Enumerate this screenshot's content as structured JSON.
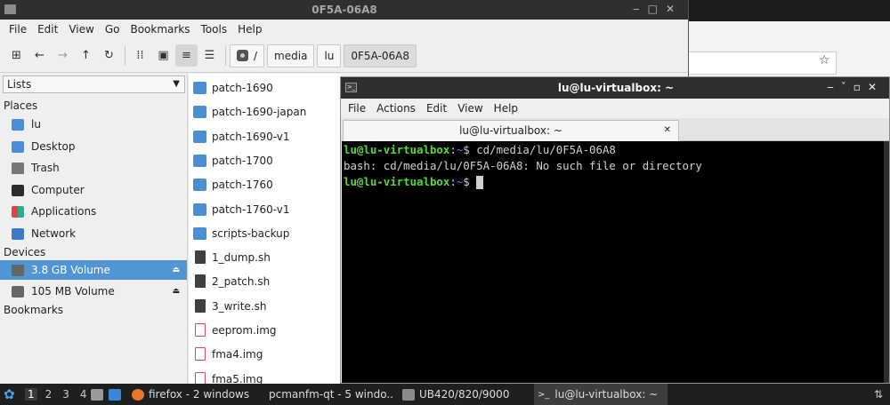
{
  "file_manager": {
    "title": "0F5A-06A8",
    "menu": [
      "File",
      "Edit",
      "View",
      "Go",
      "Bookmarks",
      "Tools",
      "Help"
    ],
    "path_crumbs": [
      "/",
      "media",
      "lu",
      "0F5A-06A8"
    ],
    "sidebar": {
      "mode": "Lists",
      "places_header": "Places",
      "places": [
        {
          "label": "lu",
          "icon": "home-folder-icon"
        },
        {
          "label": "Desktop",
          "icon": "folder-icon"
        },
        {
          "label": "Trash",
          "icon": "trash-icon"
        },
        {
          "label": "Computer",
          "icon": "computer-icon"
        },
        {
          "label": "Applications",
          "icon": "applications-icon"
        },
        {
          "label": "Network",
          "icon": "network-icon"
        }
      ],
      "devices_header": "Devices",
      "devices": [
        {
          "label": "3.8 GB Volume",
          "icon": "drive-icon",
          "selected": true
        },
        {
          "label": "105 MB Volume",
          "icon": "drive-icon",
          "selected": false
        }
      ],
      "bookmarks_header": "Bookmarks"
    },
    "files": [
      {
        "name": "patch-1690",
        "type": "folder"
      },
      {
        "name": "patch-1690-japan",
        "type": "folder"
      },
      {
        "name": "patch-1690-v1",
        "type": "folder"
      },
      {
        "name": "patch-1700",
        "type": "folder"
      },
      {
        "name": "patch-1760",
        "type": "folder"
      },
      {
        "name": "patch-1760-v1",
        "type": "folder"
      },
      {
        "name": "scripts-backup",
        "type": "folder"
      },
      {
        "name": "1_dump.sh",
        "type": "script"
      },
      {
        "name": "2_patch.sh",
        "type": "script"
      },
      {
        "name": "3_write.sh",
        "type": "script"
      },
      {
        "name": "eeprom.img",
        "type": "image"
      },
      {
        "name": "fma4.img",
        "type": "image"
      },
      {
        "name": "fma5.img",
        "type": "image"
      }
    ]
  },
  "terminal": {
    "title": "lu@lu-virtualbox: ~",
    "menu": [
      "File",
      "Actions",
      "Edit",
      "View",
      "Help"
    ],
    "tab_label": "lu@lu-virtualbox: ~",
    "prompt_user": "lu@lu-virtualbox",
    "prompt_sep": ":",
    "prompt_path": "~",
    "prompt_symbol": "$ ",
    "command": "cd/media/lu/0F5A-06A8",
    "error": "bash: cd/media/lu/0F5A-06A8: No such file or directory"
  },
  "taskbar": {
    "desktops": [
      "1",
      "2",
      "3",
      "4"
    ],
    "tasks": [
      {
        "label": "firefox - 2 windows",
        "icon": "firefox-icon"
      },
      {
        "label": "pcmanfm-qt - 5 windo...",
        "icon": "folder-icon"
      },
      {
        "label": "UB420/820/9000",
        "icon": "keyboard-icon"
      },
      {
        "label": "lu@lu-virtualbox: ~",
        "icon": "terminal-icon"
      }
    ]
  },
  "colors": {
    "selection": "#5095d5",
    "prompt_user": "#55d93a",
    "prompt_path": "#4a84e8",
    "folder": "#4a8fd6"
  }
}
